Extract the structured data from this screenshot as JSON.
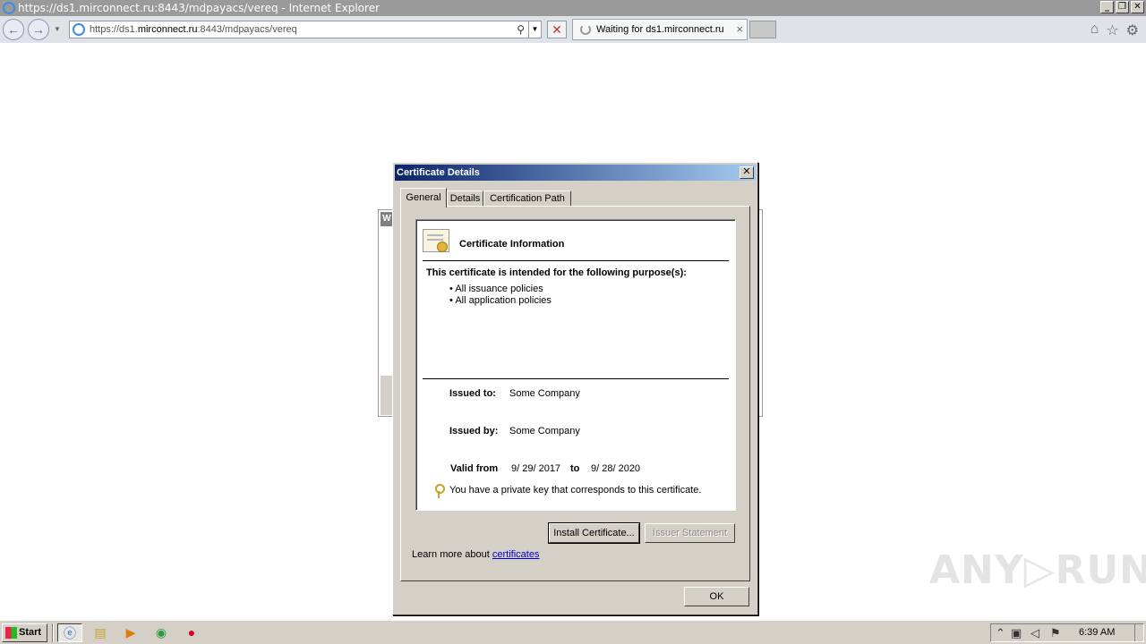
{
  "window": {
    "title": "https://ds1.mirconnect.ru:8443/mdpayacs/vereq - Internet Explorer",
    "minimize": "_",
    "restore": "❐",
    "close": "✕"
  },
  "browser": {
    "back_icon": "back-arrow-icon",
    "forward_icon": "forward-arrow-icon",
    "url_prefix": "https://ds1.",
    "url_domain": "mirconnect.ru",
    "url_suffix": ":8443/mdpayacs/vereq",
    "tab_label": "Waiting for ds1.mirconnect.ru",
    "tab_close": "×",
    "stop": "✕",
    "icons": [
      "home-icon",
      "favorites-star-icon",
      "tools-gear-icon"
    ]
  },
  "background_window": {
    "letter": "W"
  },
  "dialog": {
    "title": "Certificate Details",
    "close": "✕",
    "tabs": [
      {
        "label": "General",
        "active": true
      },
      {
        "label": "Details",
        "active": false
      },
      {
        "label": "Certification Path",
        "active": false
      }
    ],
    "info_heading": "Certificate Information",
    "purpose_heading": "This certificate is intended for the following purpose(s):",
    "purposes": [
      "All issuance policies",
      "All application policies"
    ],
    "issued_to_label": "Issued to:",
    "issued_to": "Some Company",
    "issued_by_label": "Issued by:",
    "issued_by": "Some Company",
    "valid_from_label": "Valid from",
    "valid_from": "9/ 29/ 2017",
    "valid_to_label": "to",
    "valid_to": "9/ 28/ 2020",
    "private_key_note": "You have a private key that corresponds to this certificate.",
    "install_button": "Install Certificate...",
    "issuer_statement_button": "Issuer Statement",
    "learn_more_prefix": "Learn more about",
    "learn_more_link": "certificates",
    "ok_button": "OK"
  },
  "watermark": "ANY▷RUN",
  "taskbar": {
    "start": "Start",
    "clock": "6:39 AM",
    "tray_show_hidden": "⌃"
  }
}
